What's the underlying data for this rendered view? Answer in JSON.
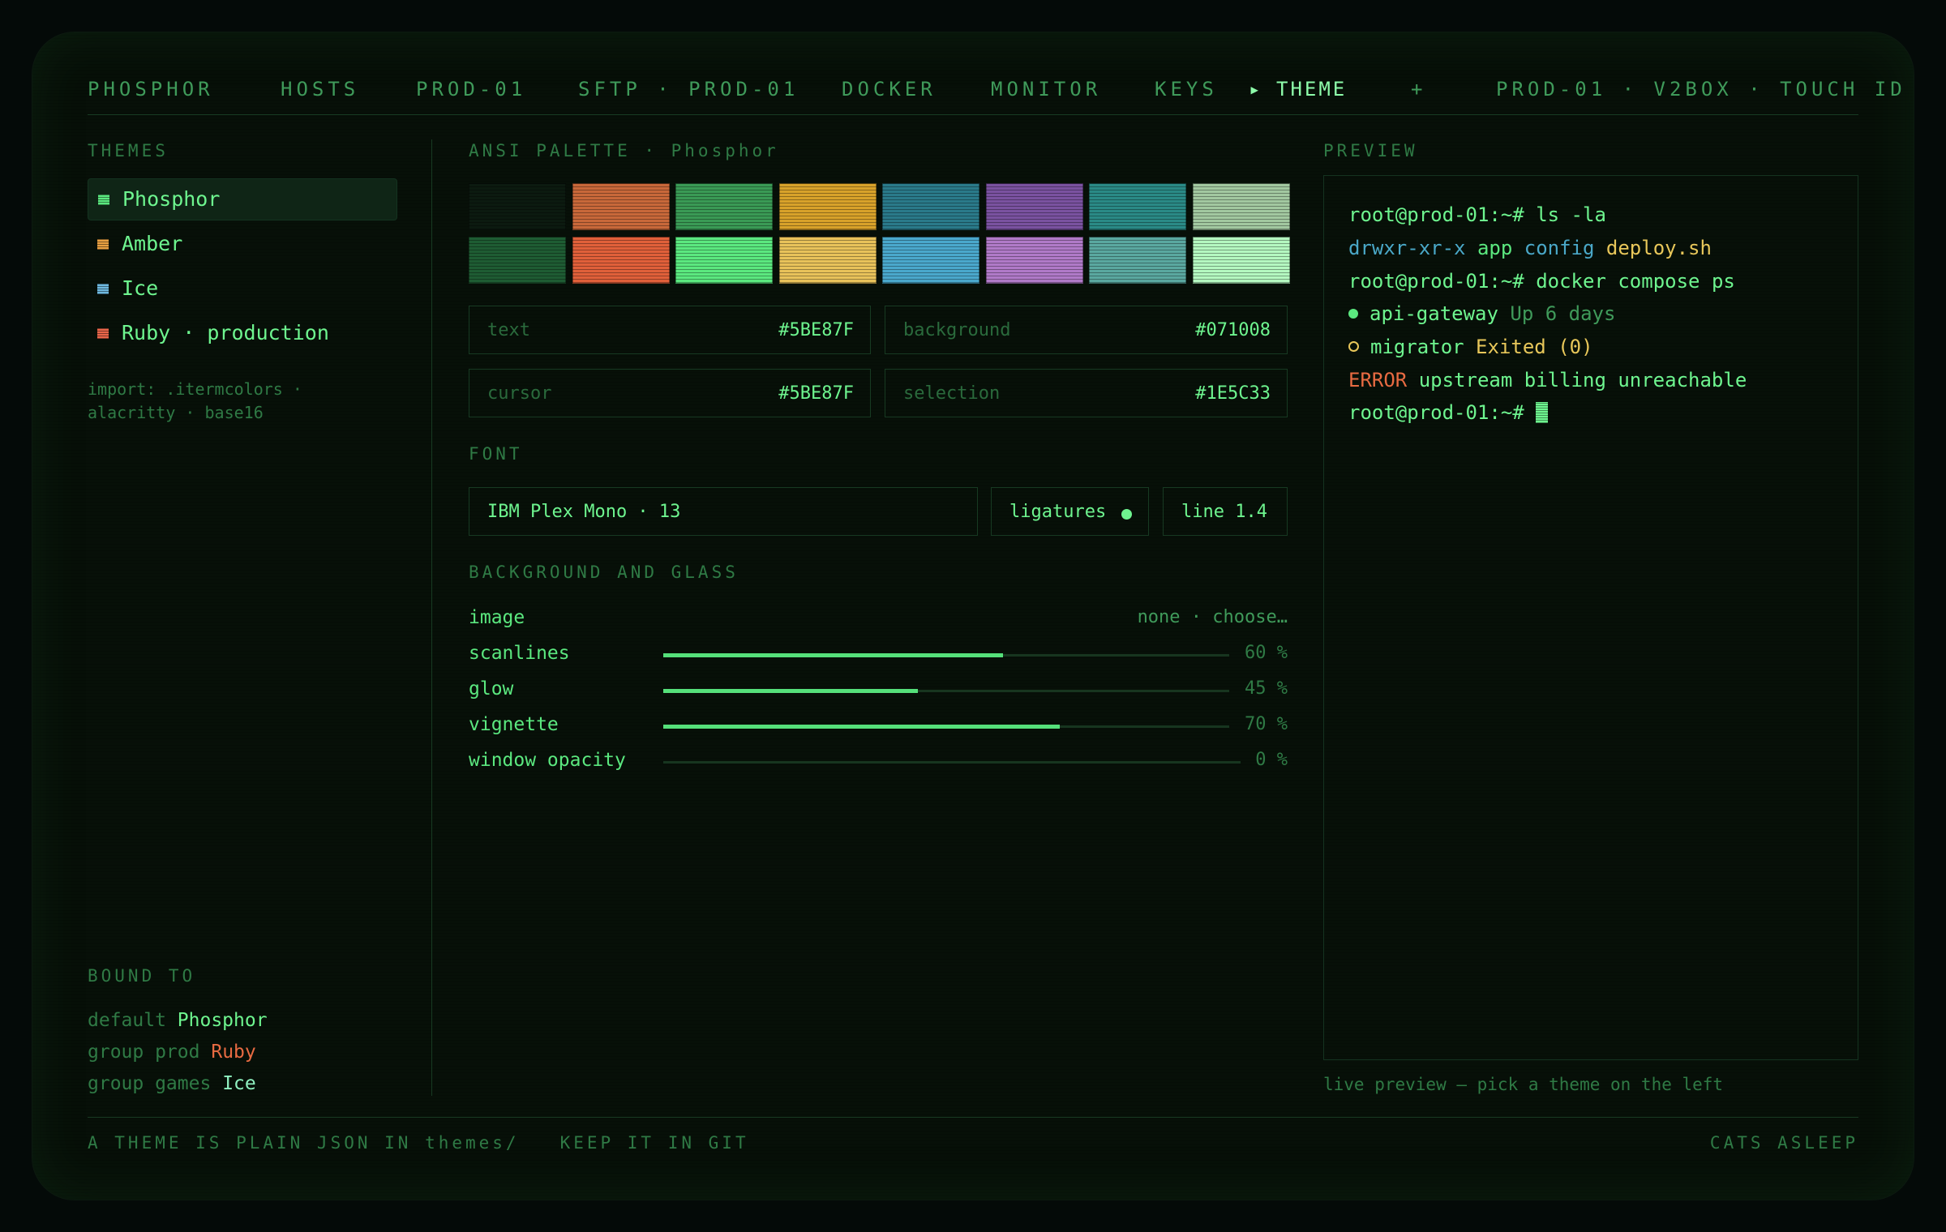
{
  "nav": {
    "brand": "PHOSPHOR",
    "tabs": [
      "HOSTS",
      "PROD-01",
      "SFTP · PROD-01",
      "DOCKER",
      "MONITOR",
      "KEYS"
    ],
    "active_marker": "▸",
    "active_tab": "THEME",
    "add": "+",
    "status": "PROD-01 · V2BOX · TOUCH ID"
  },
  "sidebar": {
    "heading": "THEMES",
    "themes": [
      {
        "name": "Phosphor",
        "color": "#5BE87F"
      },
      {
        "name": "Amber",
        "color": "#E8A042"
      },
      {
        "name": "Ice",
        "color": "#6EB8DE"
      },
      {
        "name": "Ruby · production",
        "color": "#E8664A"
      }
    ],
    "import_line1": "import: .itermcolors ·",
    "import_line2": "alacritty · base16",
    "bound_heading": "BOUND TO",
    "bindings": [
      {
        "scope": "default",
        "theme": "Phosphor",
        "color": "#6ef58f"
      },
      {
        "scope": "group prod",
        "theme": "Ruby",
        "color": "#e86b42"
      },
      {
        "scope": "group games",
        "theme": "Ice",
        "color": "#8ff0c0"
      }
    ]
  },
  "palette": {
    "heading": "ANSI PALETTE · Phosphor",
    "row1": [
      "#0c1a10",
      "#c8683a",
      "#3a9a55",
      "#d8a22a",
      "#2a7a8a",
      "#7a52a0",
      "#2a8a86",
      "#a2c8a0"
    ],
    "row2": [
      "#1e5c33",
      "#e0603a",
      "#5BE87F",
      "#e8c25a",
      "#4aa8cc",
      "#b07ac8",
      "#5aa8a0",
      "#b4f8c0"
    ],
    "fields": [
      {
        "key": "text",
        "value": "#5BE87F"
      },
      {
        "key": "background",
        "value": "#071008"
      },
      {
        "key": "cursor",
        "value": "#5BE87F"
      },
      {
        "key": "selection",
        "value": "#1E5C33"
      }
    ]
  },
  "font": {
    "heading": "FONT",
    "family": "IBM Plex Mono · 13",
    "ligatures": "ligatures",
    "line": "line 1.4"
  },
  "background": {
    "heading": "BACKGROUND AND GLASS",
    "image_label": "image",
    "image_value": "none · choose…",
    "sliders": [
      {
        "label": "scanlines",
        "value": 60,
        "pct": "60 %"
      },
      {
        "label": "glow",
        "value": 45,
        "pct": "45 %"
      },
      {
        "label": "vignette",
        "value": 70,
        "pct": "70 %"
      },
      {
        "label": "window opacity",
        "value": 0,
        "pct": "0 %"
      }
    ]
  },
  "preview": {
    "heading": "PREVIEW",
    "prompt1": "root@prod-01:~#",
    "cmd1": " ls -la",
    "perm": "drwxr-xr-x",
    "dir_app": " app",
    "dir_config": " config",
    "file_deploy": " deploy.sh",
    "prompt2": "root@prod-01:~#",
    "cmd2": " docker compose ps",
    "svc1": "api-gateway",
    "svc1_status": " Up 6 days",
    "svc2": "migrator",
    "svc2_status": " Exited (0)",
    "err_tag": "ERROR",
    "err_msg": " upstream billing unreachable",
    "prompt3": "root@prod-01:~# ",
    "caption": "live preview — pick a theme on the left"
  },
  "footer": {
    "left1": "A THEME IS PLAIN JSON IN themes/",
    "left2": "KEEP IT IN GIT",
    "right": "CATS ASLEEP"
  }
}
